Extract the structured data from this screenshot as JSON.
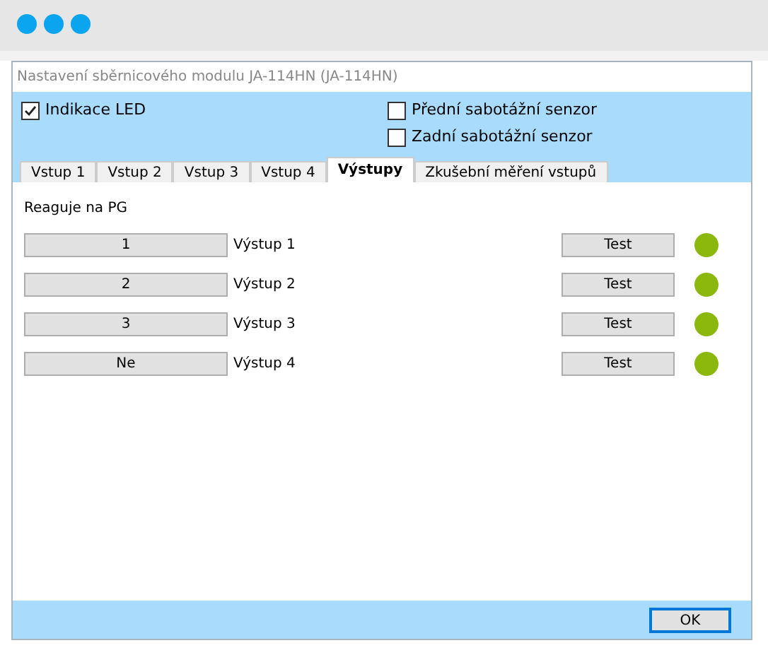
{
  "window": {
    "title": "Nastavení sběrnicového modulu JA-114HN (JA-114HN)"
  },
  "options": [
    {
      "label": "Indikace LED",
      "checked": true
    },
    {
      "label": "Přední sabotážní senzor",
      "checked": false
    },
    {
      "label": "Zadní sabotážní senzor",
      "checked": false
    }
  ],
  "tabs": [
    {
      "label": "Vstup 1",
      "selected": false
    },
    {
      "label": "Vstup 2",
      "selected": false
    },
    {
      "label": "Vstup 3",
      "selected": false
    },
    {
      "label": "Vstup 4",
      "selected": false
    },
    {
      "label": "Výstupy",
      "selected": true
    },
    {
      "label": "Zkušební měření vstupů",
      "selected": false
    }
  ],
  "section_label": "Reaguje na PG",
  "outputs": [
    {
      "pg": "1",
      "name": "Výstup 1",
      "test": "Test",
      "color": "#8cb70c"
    },
    {
      "pg": "2",
      "name": "Výstup 2",
      "test": "Test",
      "color": "#8cb70c"
    },
    {
      "pg": "3",
      "name": "Výstup 3",
      "test": "Test",
      "color": "#8cb70c"
    },
    {
      "pg": "Ne",
      "name": "Výstup 4",
      "test": "Test",
      "color": "#8cb70c"
    }
  ],
  "ok_button": "OK"
}
